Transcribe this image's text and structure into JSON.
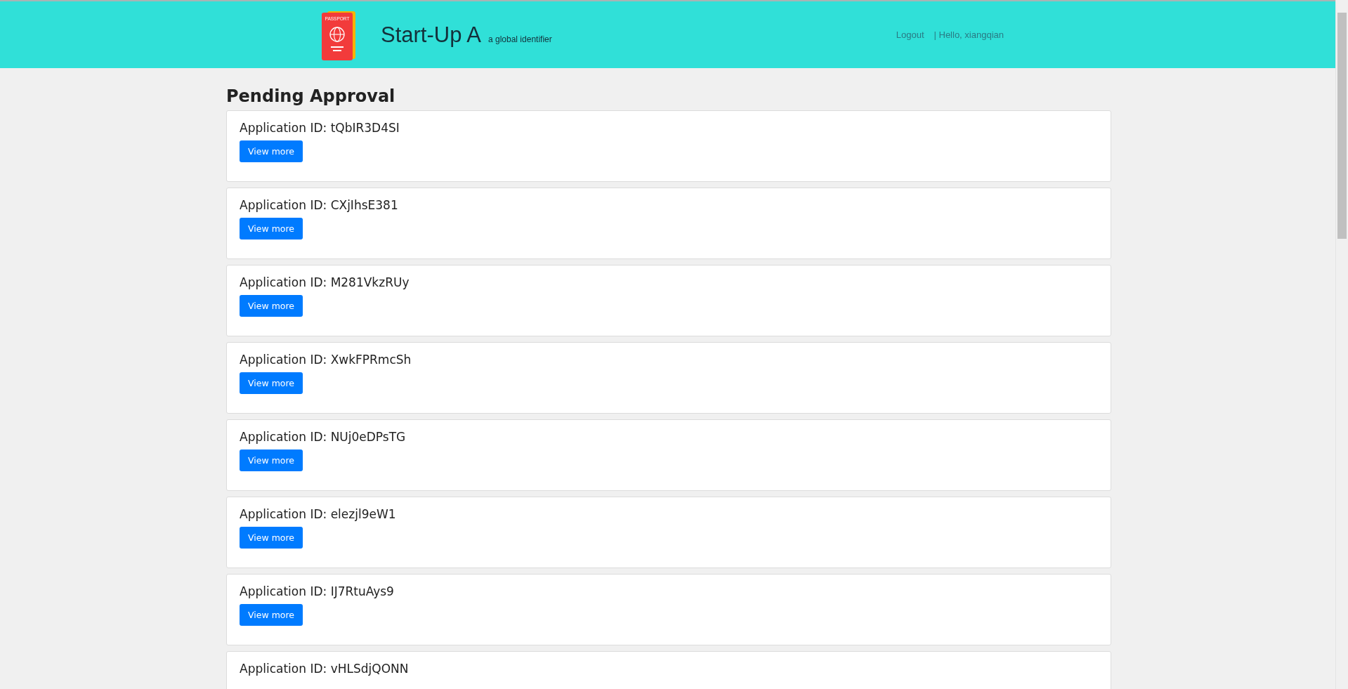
{
  "header": {
    "brand": "Start-Up A",
    "tagline": "a global identifier",
    "logo_label": "PASSPORT",
    "links": [
      {
        "label": "Logout"
      },
      {
        "label": "| Hello, xiangqian"
      }
    ]
  },
  "heading": "Pending Approval",
  "applications": [
    {
      "title": "Application ID: tQbIR3D4SI",
      "button": "View more"
    },
    {
      "title": "Application ID: CXjIhsE381",
      "button": "View more"
    },
    {
      "title": "Application ID: M281VkzRUy",
      "button": "View more"
    },
    {
      "title": "Application ID: XwkFPRmcSh",
      "button": "View more"
    },
    {
      "title": "Application ID: NUj0eDPsTG",
      "button": "View more"
    },
    {
      "title": "Application ID: elezjl9eW1",
      "button": "View more"
    },
    {
      "title": "Application ID: IJ7RtuAys9",
      "button": "View more"
    },
    {
      "title": "Application ID: vHLSdjQONN"
    }
  ]
}
